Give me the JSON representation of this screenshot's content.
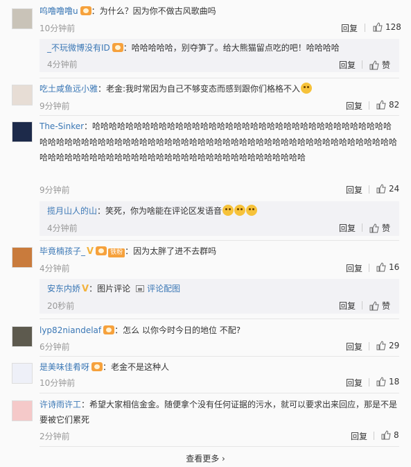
{
  "comments": [
    {
      "user": "呜噜噜噜u",
      "text": "：为什么？因为你不做古风歌曲吗",
      "time": "10分钟前",
      "reply_label": "回复",
      "likes": "128",
      "sub": {
        "user": "_不玩微博没有ID",
        "text": "：哈哈哈哈哈，别夺笋了。给大熊猫留点吃的吧！哈哈哈哈",
        "time": "4分钟前",
        "reply_label": "回复",
        "likes": "赞"
      }
    },
    {
      "user": "吃土咸鱼远小雅",
      "text": "：老金:我时常因为自己不够变态而感到跟你们格格不入",
      "time": "9分钟前",
      "reply_label": "回复",
      "likes": "82"
    },
    {
      "user": "The-Sinker",
      "text": "：哈哈哈哈哈哈哈哈哈哈哈哈哈哈哈哈哈哈哈哈哈哈哈哈哈哈哈哈哈哈哈哈哈哈哈哈哈哈哈哈哈哈哈哈哈哈哈哈哈哈哈哈哈哈哈哈哈哈哈哈哈哈哈哈哈哈哈哈哈哈哈哈哈哈哈哈哈哈哈哈哈哈哈哈哈哈哈哈哈哈哈哈哈哈哈哈哈哈哈哈哈哈哈哈哈哈哈哈哈哈哈",
      "time": "9分钟前",
      "reply_label": "回复",
      "likes": "24",
      "sub": {
        "user": "揽月山人的山",
        "text": "：笑死，你为啥能在评论区发语音",
        "time": "4分钟前",
        "reply_label": "回复",
        "likes": "赞"
      }
    },
    {
      "user": "毕竟楠孩子_",
      "fan_badge": "铁粉",
      "text": "：因为太胖了进不去群吗",
      "time": "4分钟前",
      "reply_label": "回复",
      "likes": "16",
      "sub": {
        "user": "安东内娇",
        "text": "：图片评论",
        "link": "评论配图",
        "time": "20秒前",
        "reply_label": "回复",
        "likes": "赞"
      }
    },
    {
      "user": "lyp82niandelaf",
      "text": "：怎么 以你今时今日的地位 不配?",
      "time": "6分钟前",
      "reply_label": "回复",
      "likes": "29"
    },
    {
      "user": "是美味佳肴呀",
      "text": "：老金不是这种人",
      "time": "10分钟前",
      "reply_label": "回复",
      "likes": "18"
    },
    {
      "user": "许诗雨许工",
      "text": "：希望大家相信金金。随便拿个没有任何证据的污水，就可以要求出来回应，那是不是要被它们累死",
      "time": "2分钟前",
      "reply_label": "回复",
      "likes": "8"
    }
  ],
  "more": "查看更多 ›",
  "colors": {
    "link": "#3a77b5",
    "muted": "#999999",
    "sub_bg": "#f2f2f5"
  }
}
